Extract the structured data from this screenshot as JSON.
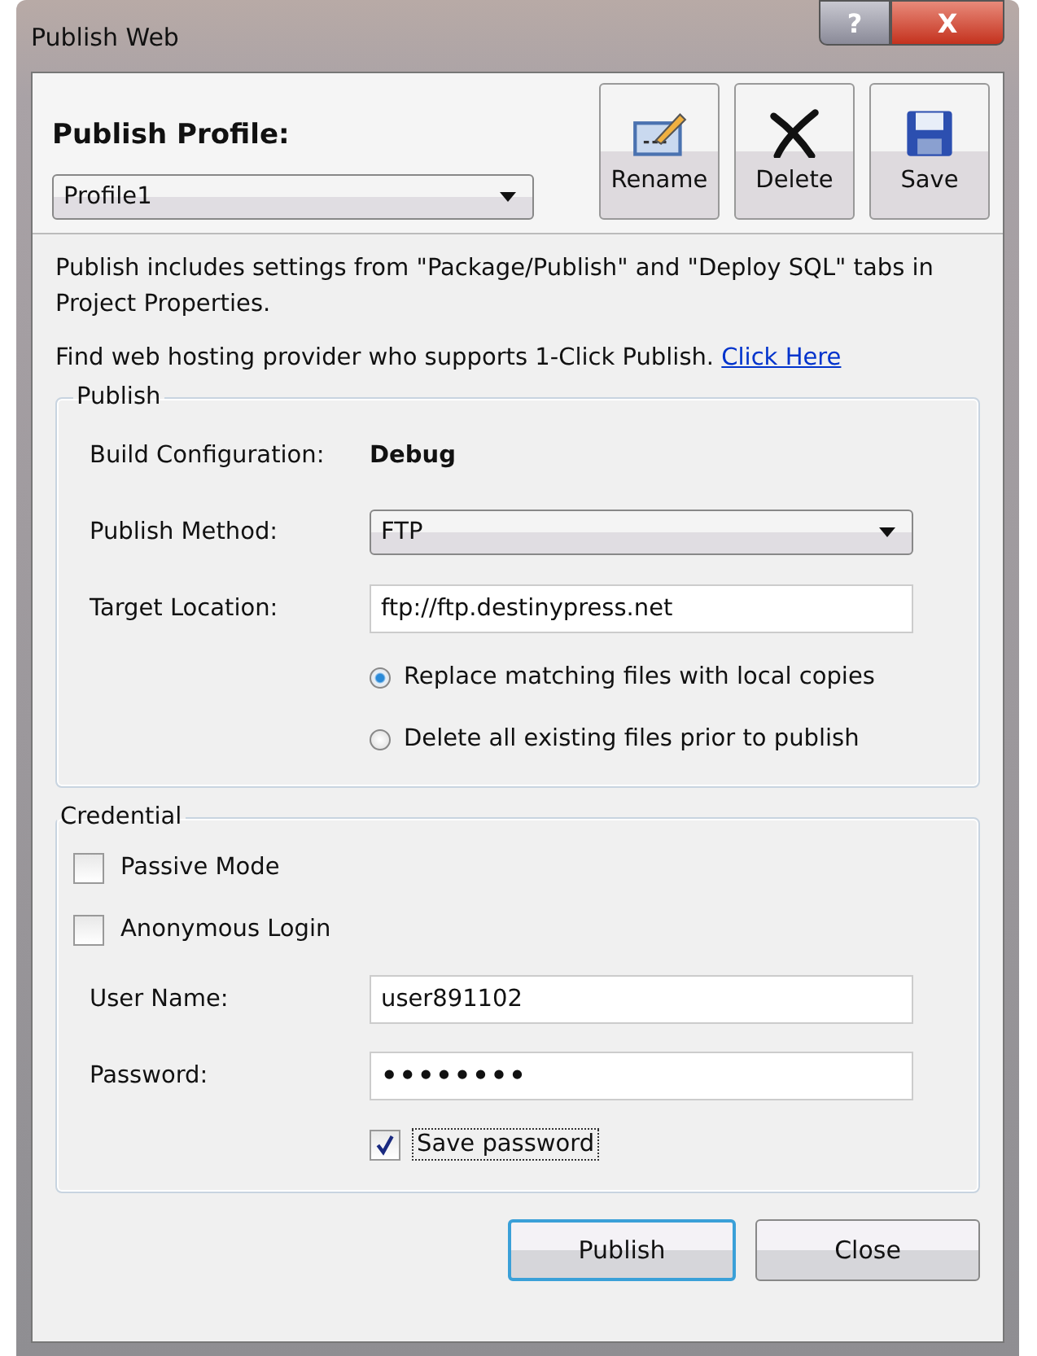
{
  "window": {
    "title": "Publish Web",
    "help_button": "?",
    "close_button": "X"
  },
  "profile": {
    "label": "Publish Profile:",
    "value": "Profile1"
  },
  "toolbar": [
    {
      "kind": "rename",
      "label": "Rename"
    },
    {
      "kind": "delete",
      "label": "Delete"
    },
    {
      "kind": "save",
      "label": "Save"
    }
  ],
  "intro": "Publish includes settings from \"Package/Publish\" and \"Deploy SQL\" tabs in Project Properties.",
  "hosting": {
    "text": "Find web hosting provider who supports 1-Click Publish.",
    "link": "Click Here"
  },
  "publish": {
    "legend": "Publish",
    "build_label": "Build Configuration:",
    "build_value": "Debug",
    "method_label": "Publish Method:",
    "method_value": "FTP",
    "location_label": "Target Location:",
    "location_value": "ftp://ftp.destinypress.net",
    "options": [
      {
        "label": "Replace matching files with local copies",
        "selected": true
      },
      {
        "label": "Delete all existing files prior to publish",
        "selected": false
      }
    ]
  },
  "credential": {
    "legend": "Credential",
    "checks": [
      {
        "label": "Passive Mode",
        "checked": false
      },
      {
        "label": "Anonymous Login",
        "checked": false
      }
    ],
    "user_label": "User Name:",
    "user_value": "user891102",
    "password_label": "Password:",
    "password_value": "••••••••",
    "save_password": {
      "label": "Save password",
      "checked": true
    }
  },
  "buttons": [
    {
      "kind": "default",
      "label": "Publish"
    },
    {
      "kind": "normal",
      "label": "Close"
    }
  ]
}
